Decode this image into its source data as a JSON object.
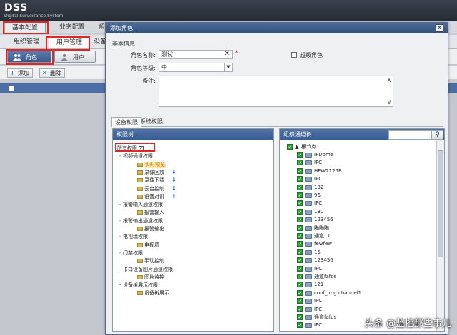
{
  "app": {
    "logo": "DSS",
    "subtitle": "Digital Surveillance System"
  },
  "top_tabs": [
    "基本配置",
    "业务配置",
    "系"
  ],
  "sub_tabs": [
    "组织管理",
    "用户管理",
    "设备"
  ],
  "role_tabs": {
    "role": "角色",
    "user": "用户"
  },
  "toolbar": {
    "add": "添加",
    "delete": "删除"
  },
  "dialog": {
    "title": "添加角色",
    "close": "×",
    "basic_info": "基本信息",
    "role_name_label": "角色名称:",
    "role_name_value": "测试",
    "required_mark": "*",
    "super_role_label": "超级角色",
    "role_level_label": "角色等级:",
    "role_level_value": "中",
    "remarks_label": "备注:",
    "perm_tabs": [
      "设备权限",
      "系统权限"
    ],
    "perm_tree_title": "权限树",
    "channel_tree_title": "组织通道树",
    "search_placeholder": ""
  },
  "perm_tree": [
    {
      "label": "所有权限",
      "level": 0,
      "checkbox": true
    },
    {
      "label": "视频通道权限",
      "level": 1
    },
    {
      "label": "实时预览",
      "level": 2,
      "selected": true
    },
    {
      "label": "录像回放",
      "level": 2,
      "arrow": true
    },
    {
      "label": "录像下载",
      "level": 2,
      "arrow": true
    },
    {
      "label": "云台控制",
      "level": 2,
      "arrow": true
    },
    {
      "label": "语音对讲",
      "level": 2,
      "arrow": true
    },
    {
      "label": "报警输入通道权限",
      "level": 1
    },
    {
      "label": "报警输入",
      "level": 2
    },
    {
      "label": "报警输出通道权限",
      "level": 1
    },
    {
      "label": "报警输出",
      "level": 2
    },
    {
      "label": "电视墙权限",
      "level": 1
    },
    {
      "label": "电视墙",
      "level": 2
    },
    {
      "label": "门禁权限",
      "level": 1
    },
    {
      "label": "手动控制",
      "level": 2
    },
    {
      "label": "卡口设备图片通道权限",
      "level": 1
    },
    {
      "label": "图片监控",
      "level": 2
    },
    {
      "label": "设备树展示权限",
      "level": 1
    },
    {
      "label": "设备树展示",
      "level": 2
    }
  ],
  "channel_root": "根节点",
  "channels": [
    "IPDome",
    "IPC",
    "HFW2125B",
    "IPC",
    "132",
    "96",
    "IPC",
    "130",
    "123456",
    "啪啪啪",
    "通道11",
    "fewfew",
    "15",
    "123456",
    "IPC",
    "通道fafds",
    "121",
    "conf_img.channel1",
    "IPC",
    "IPC",
    "通道fafds",
    "IPC"
  ],
  "watermark": "头条 @监控那些事儿",
  "colors": {
    "header": "#2c333d",
    "accent": "#4b6ea6",
    "highlight": "#e02626"
  }
}
